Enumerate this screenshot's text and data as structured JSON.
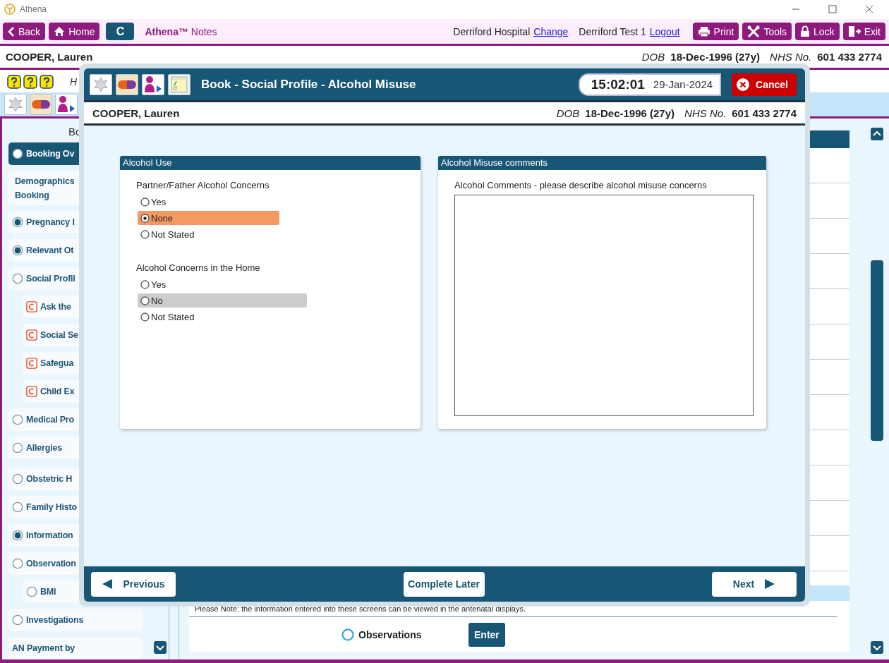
{
  "window": {
    "title": "Athena"
  },
  "toolbar": {
    "nav_buttons": [
      {
        "label": "Back",
        "kind": "back"
      },
      {
        "label": "Home",
        "kind": "home"
      },
      {
        "label": "C",
        "kind": "plain"
      }
    ],
    "app_name": "**Athena™** Notes",
    "location": "Derriford Hospital",
    "location_link": "Change",
    "user": "Derriford Test 1",
    "user_link": "Logout",
    "action_buttons": [
      {
        "label": "Print",
        "kind": "print"
      },
      {
        "label": "Tools",
        "kind": "tools"
      },
      {
        "label": "Lock",
        "kind": "lock"
      },
      {
        "label": "Exit",
        "kind": "exit"
      }
    ]
  },
  "patient_banner": {
    "name": "COOPER, Lauren",
    "dob_label": "DOB",
    "dob": "18-Dec-1996 (27y)",
    "nhs_label": "NHS No.",
    "nhs": "601 433 2774"
  },
  "help_row": {
    "text": "H"
  },
  "quick_icons": [
    {
      "kind": "star"
    },
    {
      "kind": "pill"
    },
    {
      "kind": "person"
    }
  ],
  "sidebar": {
    "heading": "Bo",
    "items": [
      {
        "label": "Booking Ov",
        "kind": "radio",
        "checked": false,
        "selected": true
      },
      {
        "label": "Demographics Booking",
        "kind": "plain",
        "selected": false
      },
      {
        "label": "Pregnancy I",
        "kind": "radio",
        "checked": true,
        "selected": false
      },
      {
        "label": "Relevant Ot",
        "kind": "radio",
        "checked": true,
        "selected": false
      },
      {
        "label": "Social Profil",
        "kind": "radio",
        "checked": false,
        "selected": false,
        "children": [
          {
            "label": "Ask the",
            "kind": "c",
            "selected": false
          },
          {
            "label": "Social Se",
            "kind": "c",
            "selected": false
          },
          {
            "label": "Safegua",
            "kind": "c",
            "selected": false
          },
          {
            "label": "Child Ex",
            "kind": "c",
            "selected": false
          }
        ]
      },
      {
        "label": "Medical Pro",
        "kind": "radio",
        "checked": false,
        "selected": false
      },
      {
        "label": "Allergies",
        "kind": "radio",
        "checked": false,
        "selected": false
      },
      {
        "label": "Obstetric H",
        "kind": "radio",
        "checked": false,
        "selected": false
      },
      {
        "label": "Family Histo",
        "kind": "radio",
        "checked": false,
        "selected": false
      },
      {
        "label": "Information",
        "kind": "radio",
        "checked": true,
        "selected": false
      },
      {
        "label": "Observation",
        "kind": "radio",
        "checked": false,
        "selected": false,
        "children": [
          {
            "label": "BMI",
            "kind": "radio",
            "checked": false,
            "selected": false
          }
        ]
      },
      {
        "label": "Investigations",
        "kind": "radio",
        "checked": false,
        "selected": false
      },
      {
        "label": "AN Payment by",
        "kind": "plain",
        "selected": false
      }
    ]
  },
  "main": {
    "note": "Please Note: the information entered into these screens can be viewed in the antenatal displays.",
    "observations": {
      "label": "Observations",
      "checked": false
    },
    "enter_button": "Enter"
  },
  "dialog": {
    "icons": [
      {
        "kind": "star"
      },
      {
        "kind": "pill"
      },
      {
        "kind": "person"
      },
      {
        "kind": "notes"
      }
    ],
    "title": "Book - Social Profile - Alcohol Misuse",
    "time": "15:02:01",
    "date": "29-Jan-2024",
    "cancel": "Cancel",
    "patient": {
      "name": "COOPER, Lauren",
      "dob_label": "DOB",
      "dob": "18-Dec-1996 (27y)",
      "nhs_label": "NHS No.",
      "nhs": "601 433 2774"
    },
    "panels": [
      {
        "title": "Alcohol Use",
        "kind": "questions",
        "questions": [
          {
            "label": "Partner/Father Alcohol Concerns",
            "options": [
              {
                "label": "Yes",
                "selected": false,
                "focused": false
              },
              {
                "label": "None",
                "selected": true,
                "focused": false
              },
              {
                "label": "Not Stated",
                "selected": false,
                "focused": false
              }
            ]
          },
          {
            "label": "Alcohol Concerns in the Home",
            "options": [
              {
                "label": "Yes",
                "selected": false,
                "focused": false
              },
              {
                "label": "No",
                "selected": false,
                "focused": true
              },
              {
                "label": "Not Stated",
                "selected": false,
                "focused": false
              }
            ]
          }
        ]
      },
      {
        "title": "Alcohol Misuse comments",
        "kind": "comments",
        "field_label": "Alcohol Comments - please describe alcohol misuse concerns"
      }
    ],
    "footer": {
      "previous": "Previous",
      "complete_later": "Complete Later",
      "next": "Next"
    }
  }
}
